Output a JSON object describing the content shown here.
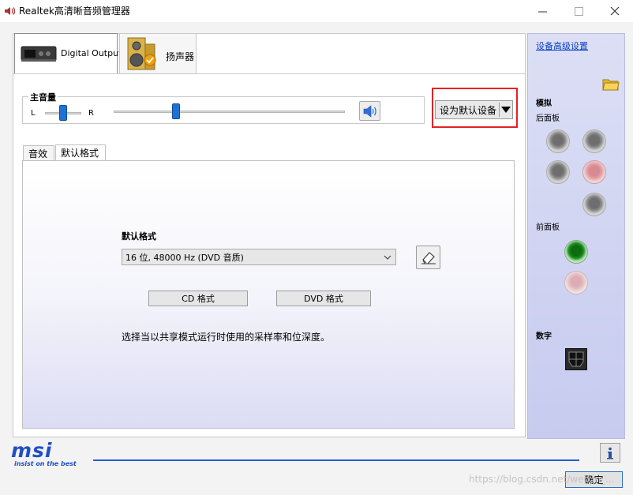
{
  "window": {
    "title": "Realtek高清晰音频管理器"
  },
  "device_tabs": [
    {
      "label": "Digital Output",
      "active": true,
      "icon": "digital-output-device-icon"
    },
    {
      "label": "扬声器",
      "active": false,
      "icon": "speaker-device-icon"
    }
  ],
  "volume": {
    "title": "主音量",
    "left_label": "L",
    "right_label": "R",
    "balance_level": 0.5,
    "master_level": 0.27
  },
  "default_device_button": {
    "label": "设为默认设备"
  },
  "sub_tabs": [
    {
      "label": "音效",
      "active": false
    },
    {
      "label": "默认格式",
      "active": true
    }
  ],
  "default_format": {
    "title": "默认格式",
    "selected": "16 位, 48000 Hz (DVD 音质)",
    "cd_button": "CD 格式",
    "dvd_button": "DVD 格式",
    "description": "选择当以共享模式运行时使用的采样率和位深度。"
  },
  "right_panel": {
    "advanced_link": "设备高级设置",
    "analog_title": "模拟",
    "rear_panel_label": "后面板",
    "front_panel_label": "前面板",
    "digital_title": "数字"
  },
  "bottom": {
    "brand": "msi",
    "tagline": "insist on the best",
    "ok_button": "确定",
    "watermark": "https://blog.csdn.net/weixin_..."
  },
  "colors": {
    "accent": "#1f72d4",
    "highlight": "#e22323",
    "link": "#0a3fc5",
    "brand_blue": "#2a5cd0"
  }
}
